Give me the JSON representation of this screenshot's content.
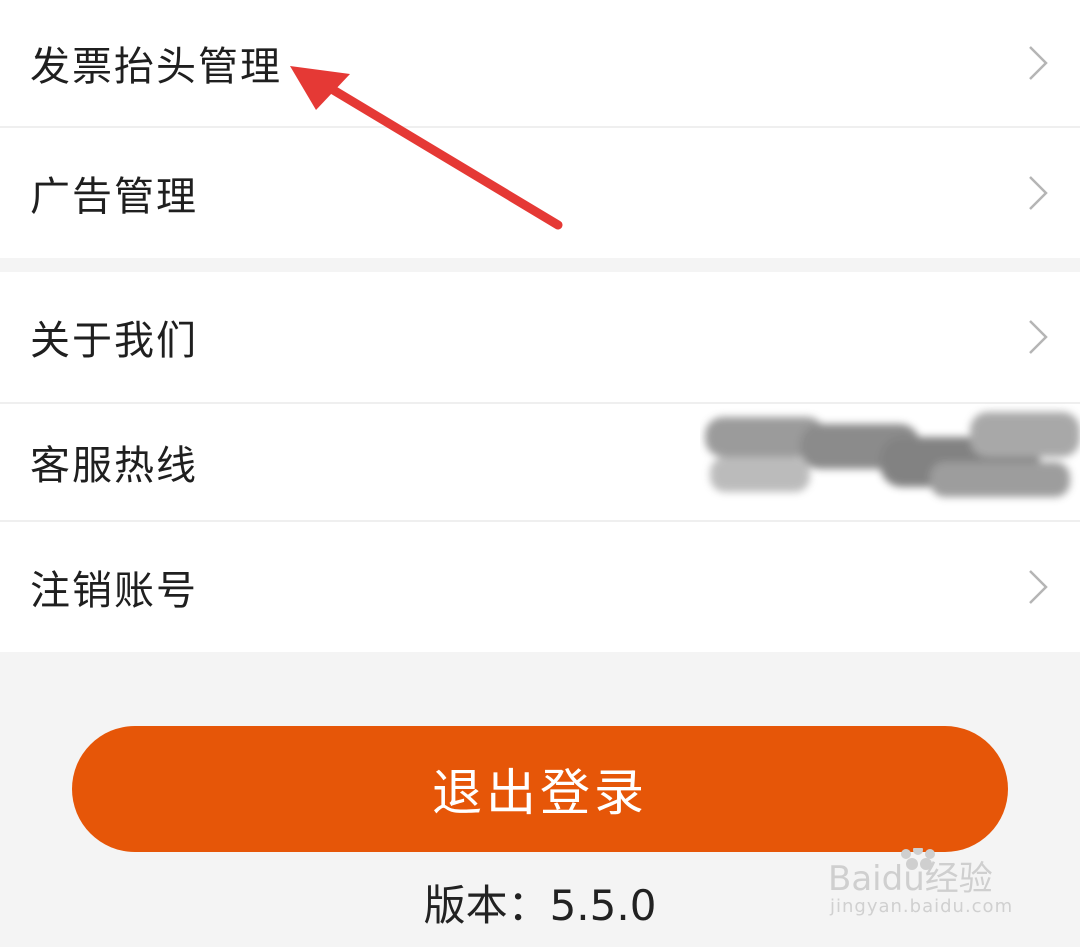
{
  "settings": {
    "group1": [
      {
        "label": "发票抬头管理",
        "chevron": "chevron-right-icon"
      },
      {
        "label": "广告管理",
        "chevron": "chevron-right-icon"
      }
    ],
    "group2": [
      {
        "label": "关于我们",
        "chevron": "chevron-right-icon"
      },
      {
        "label": "客服热线",
        "value_redacted": true
      },
      {
        "label": "注销账号",
        "chevron": "chevron-right-icon"
      }
    ]
  },
  "logout": {
    "label": "退出登录"
  },
  "version": {
    "text": "版本：5.5.0"
  },
  "annotation": {
    "arrow_color": "#e53935",
    "points_to": "发票抬头管理"
  },
  "watermark": {
    "brand": "Baidu经验",
    "url": "jingyan.baidu.com"
  },
  "colors": {
    "accent": "#e65608",
    "background": "#f4f4f4",
    "row": "#ffffff"
  }
}
